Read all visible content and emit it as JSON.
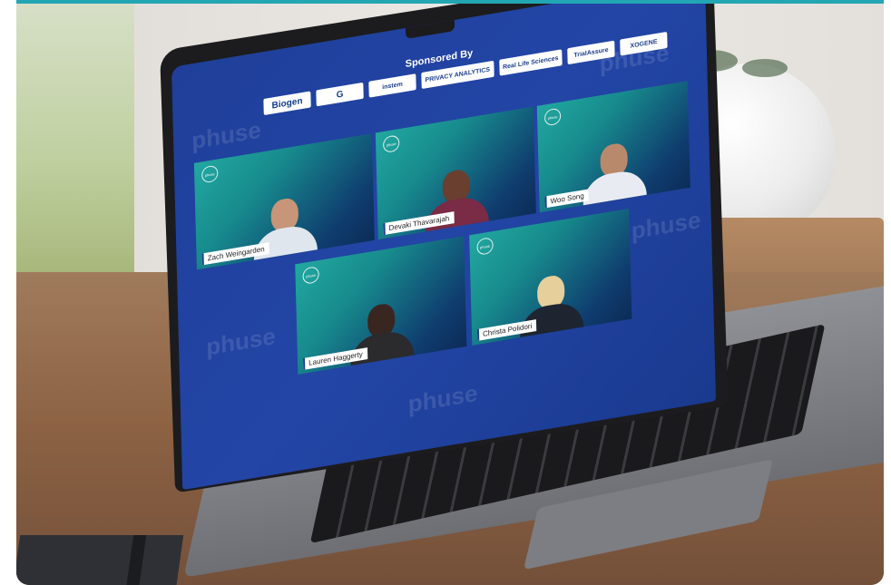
{
  "conference": {
    "sponsor_heading": "Sponsored By",
    "sponsors": [
      "Biogen",
      "G",
      "instem",
      "PRIVACY ANALYTICS",
      "Real Life Sciences",
      "TrialAssure",
      "XOGENE"
    ],
    "watermark_text": "phuse",
    "tile_logo": "phuse"
  },
  "participants": [
    {
      "name": "Zach Weingarden"
    },
    {
      "name": "Devaki Thavarajah"
    },
    {
      "name": "Woo Song"
    },
    {
      "name": "Lauren Haggerty"
    },
    {
      "name": "Christa Polidori"
    }
  ],
  "colors": {
    "accent_bar": "#23a6b4",
    "screen_bg": "#2345a6",
    "tile_teal": "#22a8a0",
    "tile_navy": "#0c2c58"
  }
}
